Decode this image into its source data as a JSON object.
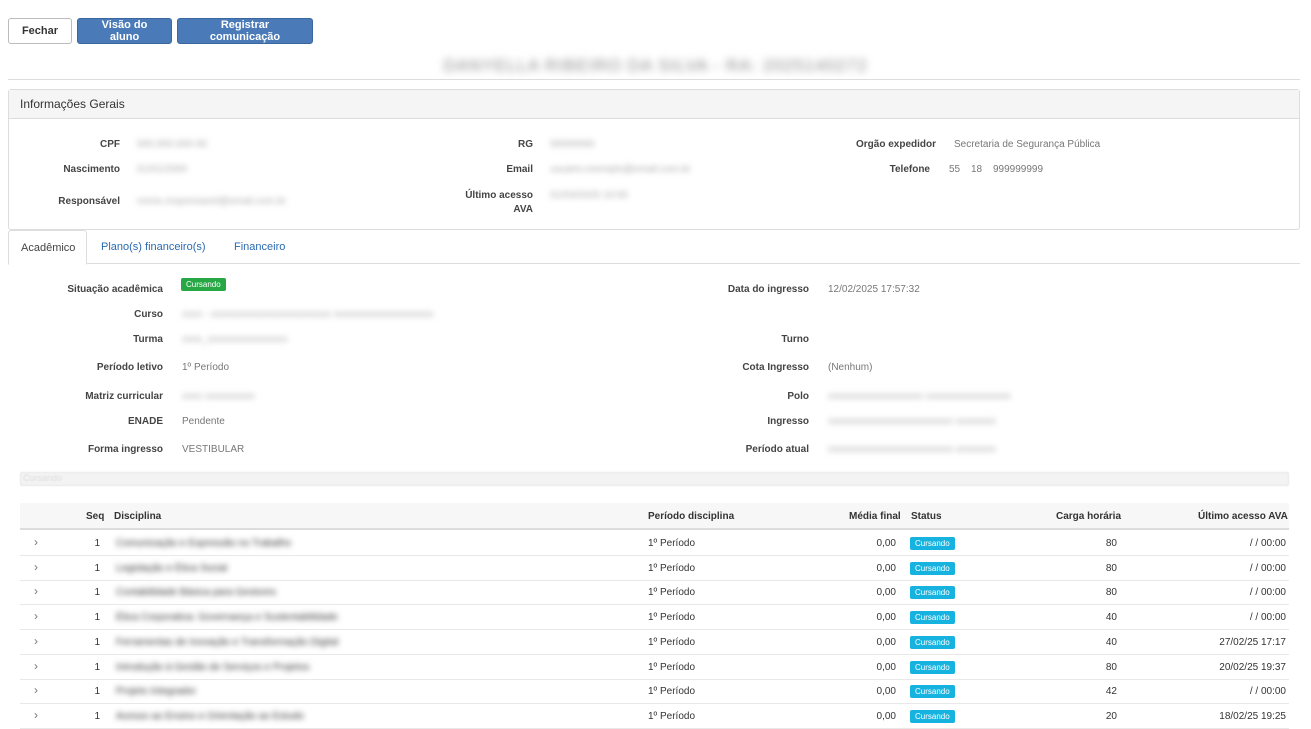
{
  "toolbar": {
    "close_label": "Fechar",
    "student_view_label": "Visão do aluno",
    "register_comm_label": "Registrar comunicação"
  },
  "student_name": "DANYELLA RIBEIRO DA SILVA - RA: 2025140272",
  "general_info": {
    "title": "Informações Gerais",
    "cpf_label": "CPF",
    "cpf_value": "000.000.000-00",
    "rg_label": "RG",
    "rg_value": "00000000",
    "orgao_label": "Orgão expedidor",
    "orgao_value": "Secretaria de Segurança Pública",
    "nascimento_label": "Nascimento",
    "nascimento_value": "01/01/2000",
    "email_label": "Email",
    "email_value": "usuario.exemplo@email.com.br",
    "telefone_label": "Telefone",
    "telefone_ddi": "55",
    "telefone_ddd": "18",
    "telefone_num": "999999999",
    "responsavel_label": "Responsável",
    "responsavel_value": "nome.responsavel@email.com.br",
    "ultimo_acesso_label_1": "Último acesso",
    "ultimo_acesso_label_2": "AVA",
    "ultimo_acesso_value": "01/03/2025 10:00"
  },
  "tabs": [
    {
      "label": "Acadêmico"
    },
    {
      "label": "Plano(s) financeiro(s)"
    },
    {
      "label": "Financeiro"
    }
  ],
  "academic": {
    "situacao_label": "Situação acadêmica",
    "situacao_value": "Cursando",
    "data_ingresso_label": "Data do ingresso",
    "data_ingresso_value": "12/02/2025 17:57:32",
    "curso_label": "Curso",
    "curso_value": "xxxx - xxxxxxxxxxxxxxxxxxxxxxxx xxxxxxxxxxxxxxxxxxxx",
    "turma_label": "Turma",
    "turma_value": "xxxx_xxxxxxxxxxxxxxxx",
    "turno_label": "Turno",
    "turno_value": "",
    "periodo_letivo_label": "Período letivo",
    "periodo_letivo_value": "1º Período",
    "cota_label": "Cota Ingresso",
    "cota_value": "(Nenhum)",
    "matriz_label": "Matriz curricular",
    "matriz_value": "xxxx xxxxxxxxxx",
    "polo_label": "Polo",
    "polo_value": "xxxxxxxxxxxxxxxxxxx xxxxxxxxxxxxxxxxx",
    "enade_label": "ENADE",
    "enade_value": "Pendente",
    "ingresso_label": "Ingresso",
    "ingresso_value": "xxxxxxxxxxxxxxxxxxxxxxxxx xxxxxxxx",
    "forma_label": "Forma ingresso",
    "forma_value": "VESTIBULAR",
    "periodo_atual_label": "Período atual",
    "periodo_atual_value": "xxxxxxxxxxxxxxxxxxxxxxxxx xxxxxxxx",
    "section_label": "Cursando"
  },
  "table": {
    "headers": {
      "seq": "Seq",
      "disciplina": "Disciplina",
      "periodo": "Período disciplina",
      "media": "Média final",
      "status": "Status",
      "carga": "Carga horária",
      "ultimo": "Último acesso AVA"
    },
    "rows": [
      {
        "seq": "1",
        "disciplina": "Comunicação e Expressão no Trabalho",
        "periodo": "1º Período",
        "media": "0,00",
        "status": "Cursando",
        "carga": "80",
        "ultimo": " / / 00:00"
      },
      {
        "seq": "1",
        "disciplina": "Legislação e Ética Social",
        "periodo": "1º Período",
        "media": "0,00",
        "status": "Cursando",
        "carga": "80",
        "ultimo": " / / 00:00"
      },
      {
        "seq": "1",
        "disciplina": "Contabilidade Básica para Gestores",
        "periodo": "1º Período",
        "media": "0,00",
        "status": "Cursando",
        "carga": "80",
        "ultimo": " / / 00:00"
      },
      {
        "seq": "1",
        "disciplina": "Ética Corporativa: Governança e Sustentabilidade",
        "periodo": "1º Período",
        "media": "0,00",
        "status": "Cursando",
        "carga": "40",
        "ultimo": " / / 00:00"
      },
      {
        "seq": "1",
        "disciplina": "Ferramentas de Inovação e Transformação Digital",
        "periodo": "1º Período",
        "media": "0,00",
        "status": "Cursando",
        "carga": "40",
        "ultimo": "27/02/25 17:17"
      },
      {
        "seq": "1",
        "disciplina": "Introdução à Gestão de Serviços e Projetos",
        "periodo": "1º Período",
        "media": "0,00",
        "status": "Cursando",
        "carga": "80",
        "ultimo": "20/02/25 19:37"
      },
      {
        "seq": "1",
        "disciplina": "Projeto Integrador",
        "periodo": "1º Período",
        "media": "0,00",
        "status": "Cursando",
        "carga": "42",
        "ultimo": " / / 00:00"
      },
      {
        "seq": "1",
        "disciplina": "Acesso ao Ensino e Orientação ao Estudo",
        "periodo": "1º Período",
        "media": "0,00",
        "status": "Cursando",
        "carga": "20",
        "ultimo": "18/02/25 19:25"
      }
    ]
  },
  "colors": {
    "primary_button": "#4a7ab8",
    "badge_green": "#28a745",
    "badge_cyan": "#17b3e0",
    "link": "#2a6ab0"
  }
}
